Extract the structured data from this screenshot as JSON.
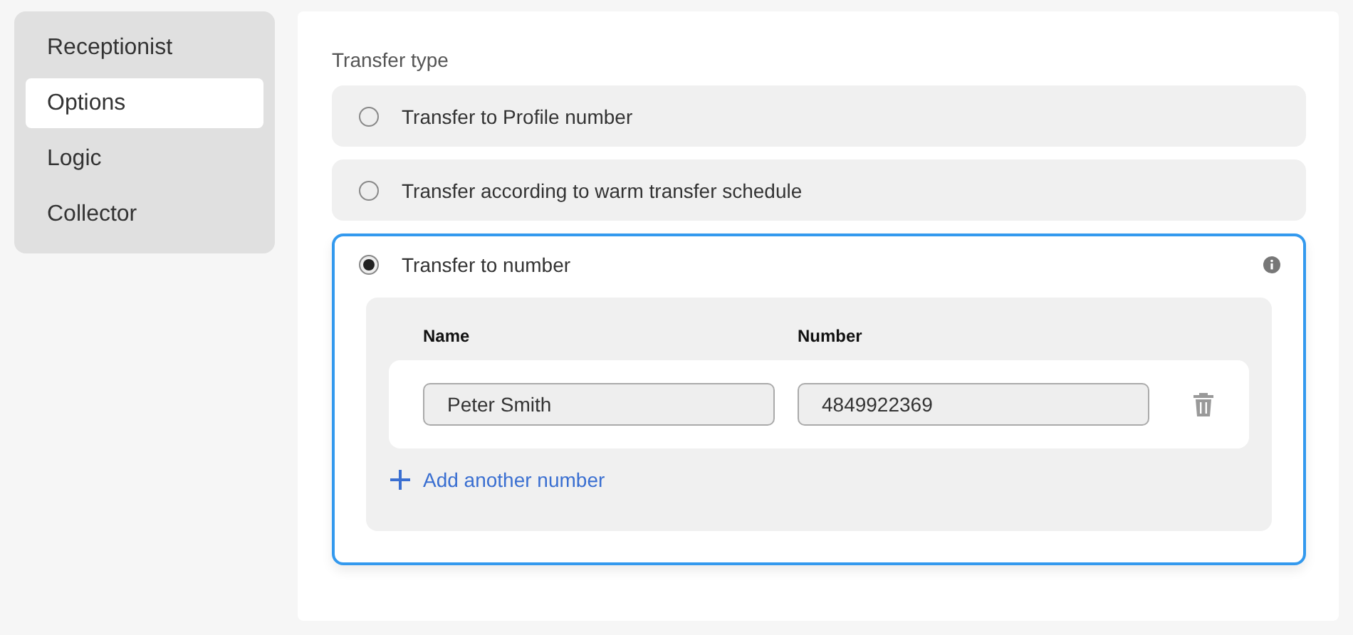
{
  "sidebar": {
    "items": [
      {
        "label": "Receptionist",
        "selected": false
      },
      {
        "label": "Options",
        "selected": true
      },
      {
        "label": "Logic",
        "selected": false
      },
      {
        "label": "Collector",
        "selected": false
      }
    ]
  },
  "transfer_type": {
    "label": "Transfer type",
    "options": [
      {
        "label": "Transfer to Profile number",
        "selected": false
      },
      {
        "label": "Transfer according to warm transfer schedule",
        "selected": false
      },
      {
        "label": "Transfer to number",
        "selected": true,
        "info": true
      }
    ]
  },
  "numbers": {
    "columns": [
      "Name",
      "Number"
    ],
    "rows": [
      {
        "name": "Peter Smith",
        "number": "4849922369"
      }
    ],
    "add_label": "Add another number"
  }
}
